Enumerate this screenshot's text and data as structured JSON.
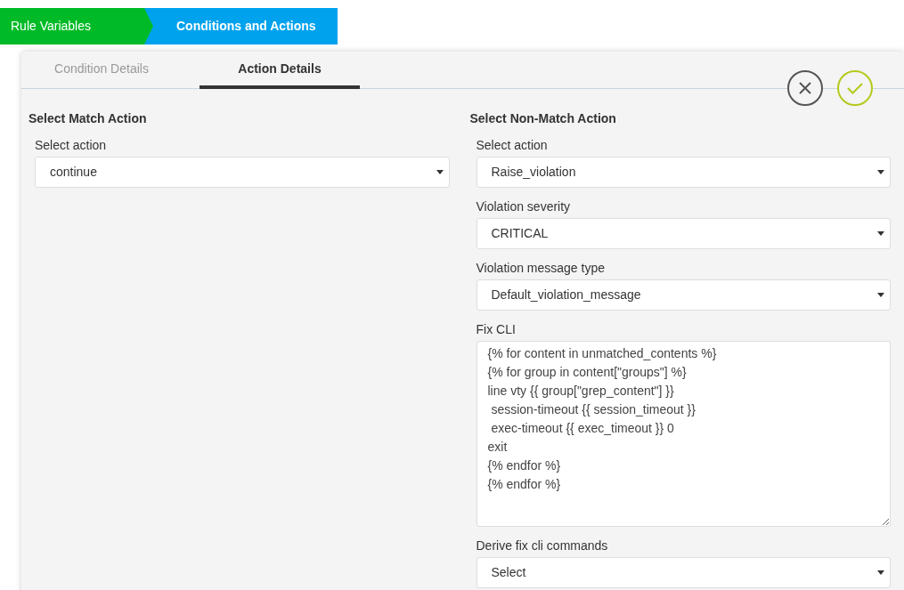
{
  "breadcrumb": [
    {
      "label": "Rule Variables",
      "selected": false,
      "color": "#00bb27"
    },
    {
      "label": "Conditions and Actions",
      "selected": true,
      "color": "#00a2ed"
    }
  ],
  "tabs": [
    {
      "label": "Condition Details",
      "selected": false
    },
    {
      "label": "Action Details",
      "selected": true
    }
  ],
  "match_action": {
    "title": "Select Match Action",
    "fields": [
      {
        "kind": "select",
        "label": "Select action",
        "value": "continue"
      }
    ]
  },
  "non_match_action": {
    "title": "Select Non-Match Action",
    "fields": [
      {
        "kind": "select",
        "label": "Select action",
        "value": "Raise_violation"
      },
      {
        "kind": "select",
        "label": "Violation severity",
        "value": "CRITICAL"
      },
      {
        "kind": "select",
        "label": "Violation message type",
        "value": "Default_violation_message"
      },
      {
        "kind": "textarea",
        "label": "Fix CLI",
        "lines": [
          "{% for content in unmatched_contents %}",
          "{% for group in content[\"groups\"] %}",
          "line vty {{ group[\"grep_content\"] }}",
          " session-timeout {{ session_timeout }}",
          " exec-timeout {{ exec_timeout }} 0",
          "exit",
          "{% endfor %}",
          "{% endfor %}"
        ]
      },
      {
        "kind": "select",
        "label": "Derive fix cli commands",
        "value": "Select"
      }
    ]
  }
}
